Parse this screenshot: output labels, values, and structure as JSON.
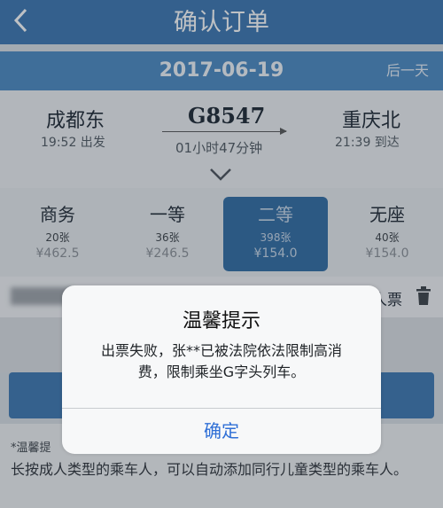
{
  "header": {
    "back_icon": "chevron-left-icon",
    "title": "确认订单"
  },
  "date_bar": {
    "date": "2017-06-19",
    "next_label": "后一天"
  },
  "train": {
    "from_station": "成都东",
    "depart_time": "19:52 出发",
    "train_no": "G8547",
    "duration": "01小时47分钟",
    "to_station": "重庆北",
    "arrive_time": "21:39 到达"
  },
  "seats": [
    {
      "name": "商务",
      "count": "20张",
      "price": "¥462.5"
    },
    {
      "name": "一等",
      "count": "36张",
      "price": "¥246.5"
    },
    {
      "name": "二等",
      "count": "398张",
      "price": "¥154.0"
    },
    {
      "name": "无座",
      "count": "40张",
      "price": "¥154.0"
    }
  ],
  "passenger": {
    "type_label": "人票"
  },
  "tips": {
    "line1": "*温馨提",
    "line2": "长按成人类型的乘车人，可以自动添加同行儿童类型的乘车人。"
  },
  "dialog": {
    "title": "温馨提示",
    "message": "出票失败，张**已被法院依法限制高消费，限制乘坐G字头列车。",
    "confirm": "确定"
  },
  "colors": {
    "nav": "#3a74b0",
    "selected_seat": "#2f6aa3",
    "dialog_button": "#2f6fd6"
  }
}
